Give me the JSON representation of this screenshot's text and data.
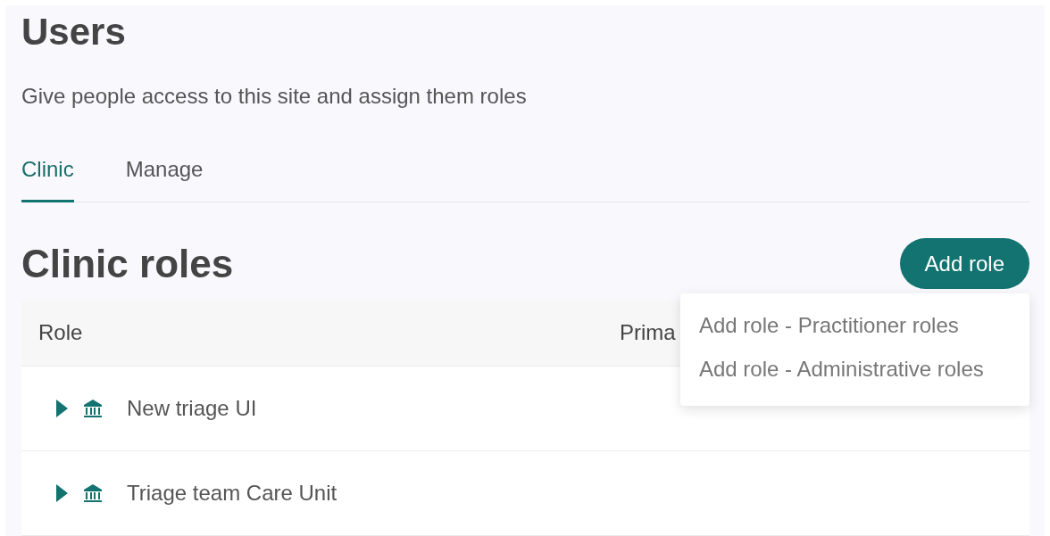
{
  "page": {
    "title": "Users",
    "subtitle": "Give people access to this site and assign them roles"
  },
  "tabs": [
    {
      "label": "Clinic",
      "selected": true
    },
    {
      "label": "Manage",
      "selected": false
    }
  ],
  "section": {
    "title": "Clinic roles",
    "add_button": "Add role"
  },
  "add_menu": {
    "open": true,
    "items": [
      "Add role - Practitioner roles",
      "Add role - Administrative roles"
    ]
  },
  "table": {
    "columns": [
      "Role",
      "Prima"
    ],
    "rows": [
      {
        "name": "New triage UI",
        "expanded": false
      },
      {
        "name": "Triage team Care Unit",
        "expanded": false
      }
    ]
  }
}
